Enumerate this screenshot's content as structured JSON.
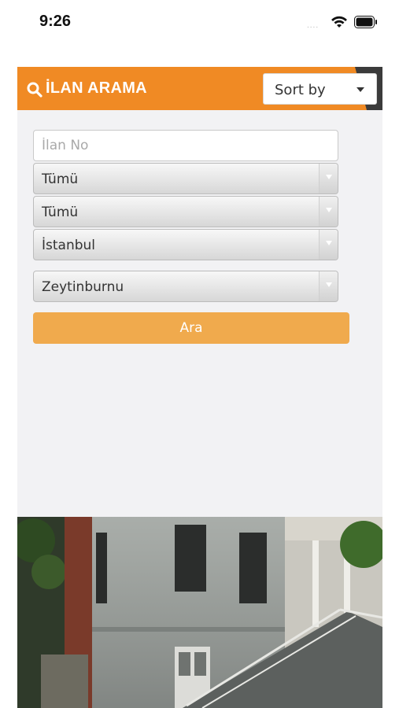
{
  "status_bar": {
    "time": "9:26",
    "signal": "....",
    "wifi_icon": "wifi-icon",
    "battery_icon": "battery-icon"
  },
  "header": {
    "search_icon": "search-icon",
    "title": "İLAN ARAMA",
    "sort_label": "Sort by",
    "sort_icon": "caret-down-icon"
  },
  "form": {
    "ilan_no_placeholder": "İlan No",
    "selects": [
      "Tümü",
      "Tümü",
      "İstanbul",
      "Zeytinburnu"
    ],
    "submit_label": "Ara"
  },
  "colors": {
    "header_orange": "#f08a24",
    "button_orange": "#f0aa4d",
    "header_dark": "#3b3b3b"
  }
}
